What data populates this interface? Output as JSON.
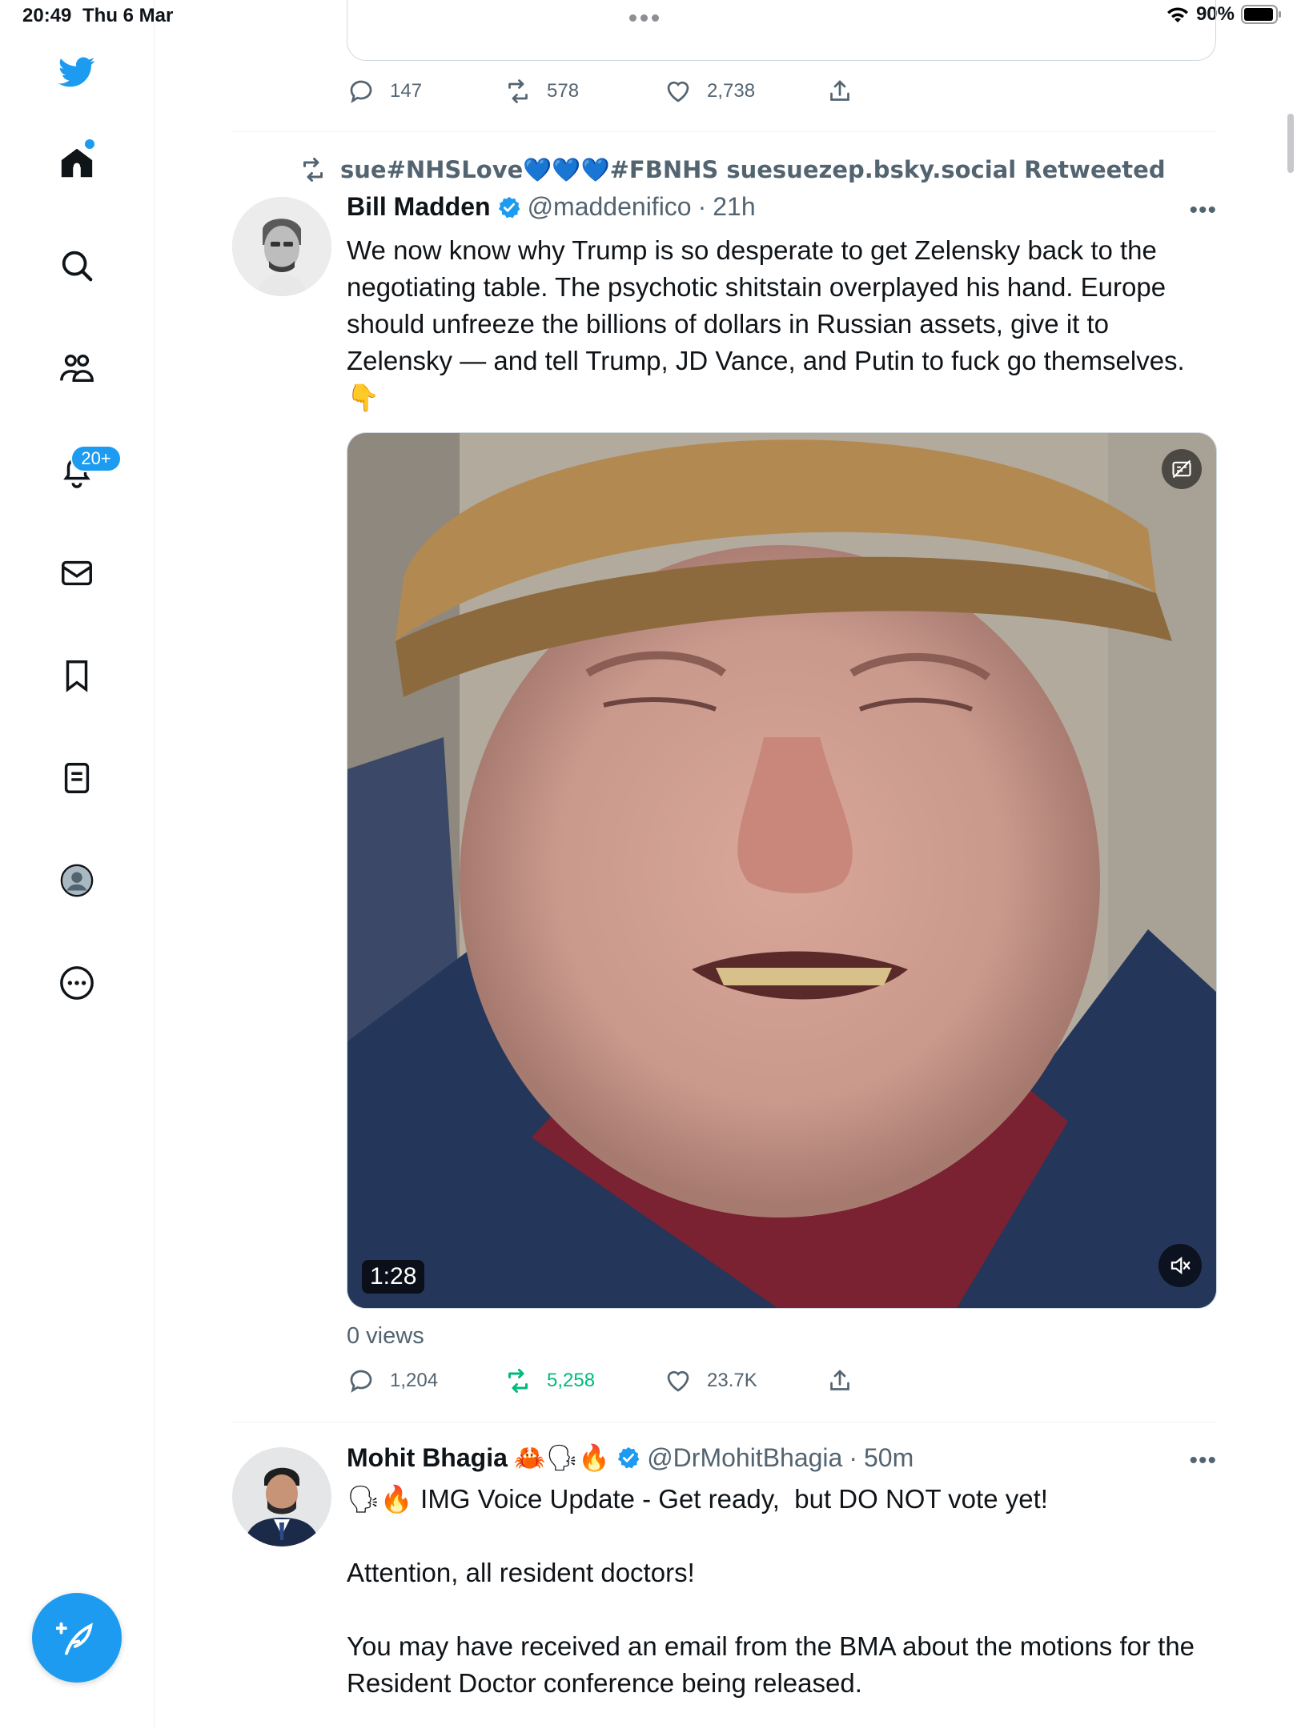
{
  "status_bar": {
    "time": "20:49",
    "date": "Thu 6 Mar",
    "battery": "90%"
  },
  "sidebar": {
    "items": [
      {
        "name": "twitter-logo",
        "icon": "bird-icon"
      },
      {
        "name": "home",
        "icon": "home-icon"
      },
      {
        "name": "explore",
        "icon": "search-icon"
      },
      {
        "name": "communities",
        "icon": "people-icon"
      },
      {
        "name": "notifications",
        "icon": "bell-icon",
        "badge": "20+"
      },
      {
        "name": "messages",
        "icon": "mail-icon"
      },
      {
        "name": "bookmarks",
        "icon": "bookmark-icon"
      },
      {
        "name": "lists",
        "icon": "list-icon"
      },
      {
        "name": "profile",
        "icon": "avatar-icon"
      },
      {
        "name": "more",
        "icon": "more-circle-icon"
      }
    ],
    "notification_badge": "20+"
  },
  "previous_tweet": {
    "replies": "147",
    "retweets": "578",
    "likes": "2,738"
  },
  "tweet1": {
    "retweet_context": "sue#NHSLove💙💙💙#FBNHS suesuezep.bsky.social Retweeted",
    "author_name": "Bill Madden",
    "handle": "@maddenifico",
    "sep": "·",
    "time": "21h",
    "text": "We now know why Trump is so desperate to get Zelensky back to the negotiating table. The psychotic shitstain overplayed his hand. Europe should unfreeze the billions of dollars in Russian assets, give it to Zelensky — and tell Trump, JD Vance, and Putin to fuck go themselves.\n👇",
    "video_duration": "1:28",
    "views": "0 views",
    "replies": "1,204",
    "retweets": "5,258",
    "likes": "23.7K"
  },
  "tweet2": {
    "author_name": "Mohit Bhagia",
    "name_emojis": "🦀🗣🔥",
    "handle": "@DrMohitBhagia",
    "sep": "·",
    "time": "50m",
    "text": "🗣🔥 IMG Voice Update - Get ready,  but DO NOT vote yet!\n\nAttention, all resident doctors!\n\nYou may have received an email from the BMA about the motions for the Resident Doctor conference being released."
  },
  "colors": {
    "accent": "#1d9bf0",
    "text_secondary": "#536471",
    "retweet_green": "#00ba7c"
  }
}
